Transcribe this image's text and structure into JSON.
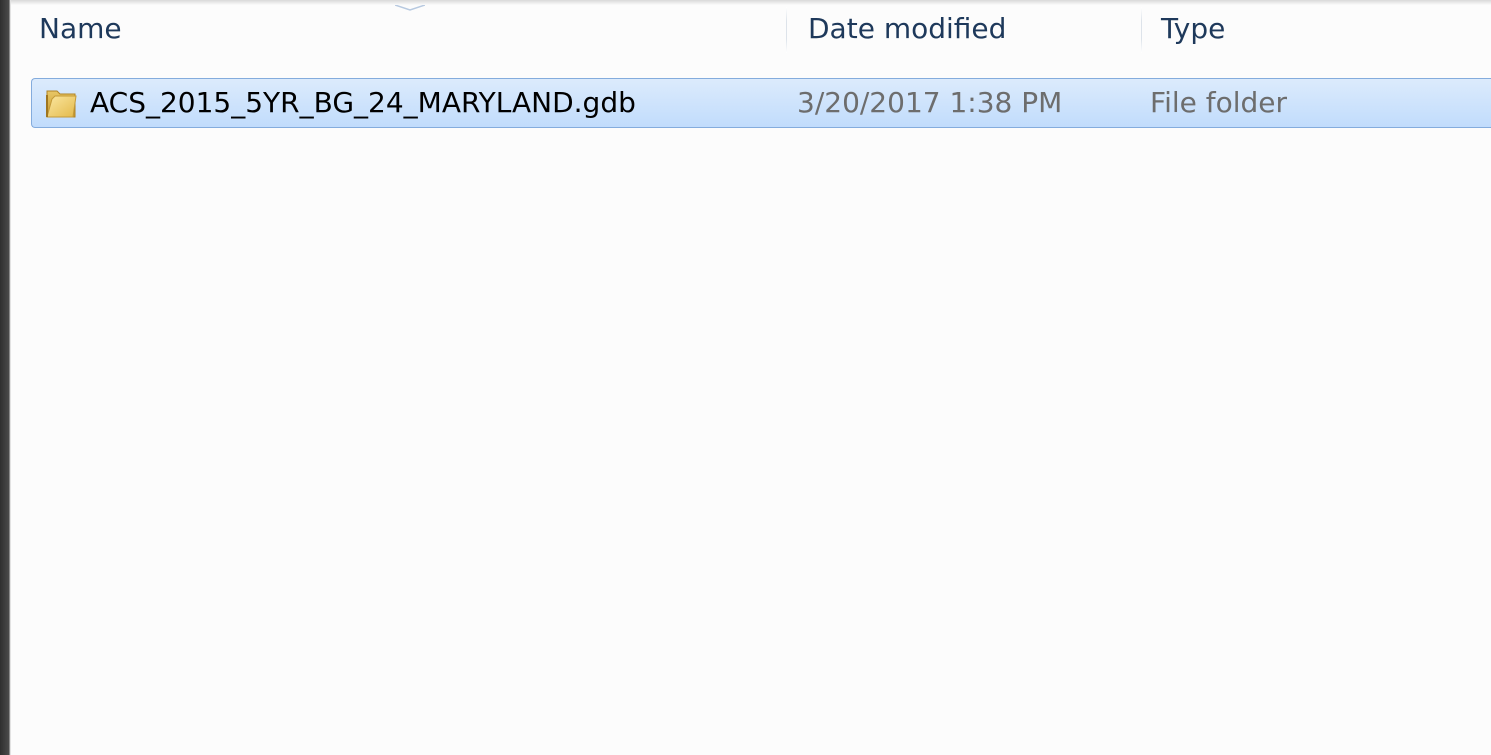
{
  "columns": {
    "name": "Name",
    "date_modified": "Date modified",
    "type": "Type"
  },
  "files": [
    {
      "name": "ACS_2015_5YR_BG_24_MARYLAND.gdb",
      "date_modified": "3/20/2017 1:38 PM",
      "type": "File folder",
      "icon": "folder-icon",
      "selected": true
    }
  ],
  "colors": {
    "header_text": "#1e395b",
    "selection_fill": "#c1dcfc",
    "selection_border": "#84acdd",
    "secondary_text": "#6d6d6d"
  }
}
